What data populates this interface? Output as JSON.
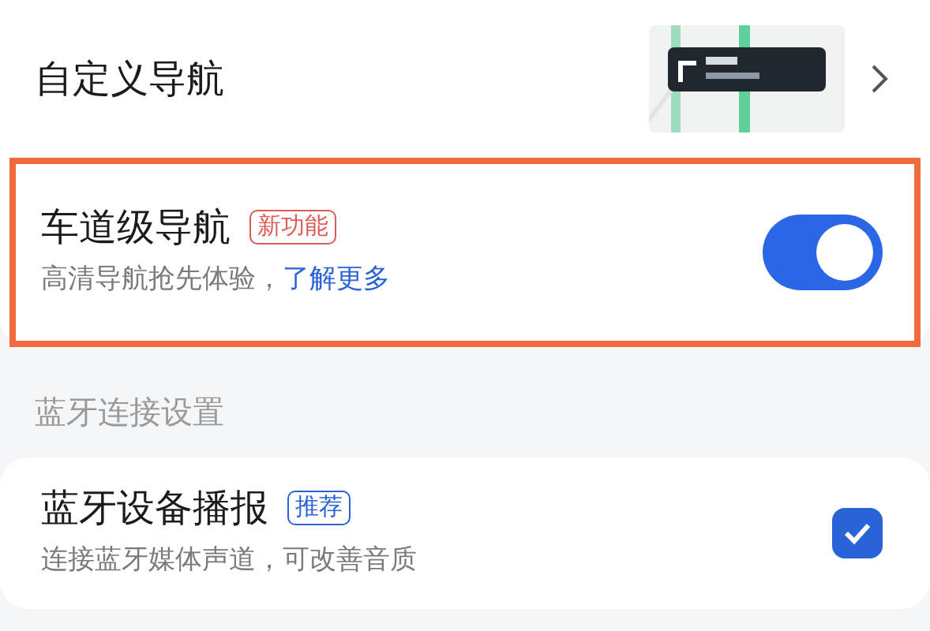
{
  "sections": [
    {
      "rows": [
        {
          "kind": "link",
          "title": "自定义导航"
        },
        {
          "kind": "toggle",
          "title": "车道级导航",
          "tag": "新功能",
          "color": "#e05a55",
          "subtitle": "高清导航抢先体验，",
          "link": "了解更多",
          "on": true,
          "highlighted": true
        }
      ]
    },
    {
      "header": "蓝牙连接设置",
      "rows": [
        {
          "kind": "check",
          "title": "蓝牙设备播报",
          "tag": "推荐",
          "color": "#2a63d6",
          "subtitle": "连接蓝牙媒体声道，可改善音质",
          "checked": true,
          "highlighted": false
        }
      ]
    }
  ]
}
